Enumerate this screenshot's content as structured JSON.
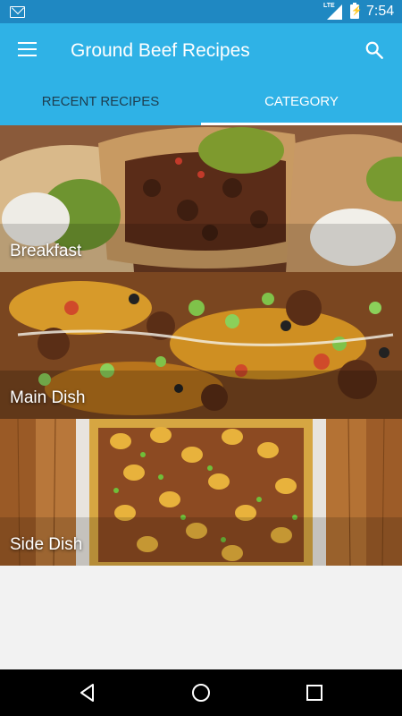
{
  "status_bar": {
    "network": "LTE",
    "time": "7:54",
    "icons": [
      "mail-icon",
      "signal-icon",
      "battery-charging-icon"
    ]
  },
  "app_bar": {
    "title": "Ground Beef Recipes",
    "menu_icon": "hamburger-menu-icon",
    "search_icon": "search-icon"
  },
  "tabs": [
    {
      "label": "RECENT RECIPES",
      "active": false
    },
    {
      "label": "CATEGORY",
      "active": true
    }
  ],
  "categories": [
    {
      "label": "Breakfast"
    },
    {
      "label": "Main Dish"
    },
    {
      "label": "Side Dish"
    }
  ],
  "nav_bar": {
    "icons": [
      "back-icon",
      "home-icon",
      "recents-icon"
    ]
  },
  "colors": {
    "status_bar": "#1f88c2",
    "app_bar": "#2fb2e6",
    "inactive_tab_text": "#1d3d4f",
    "active_tab_text": "#ffffff",
    "background": "#f2f2f2"
  }
}
